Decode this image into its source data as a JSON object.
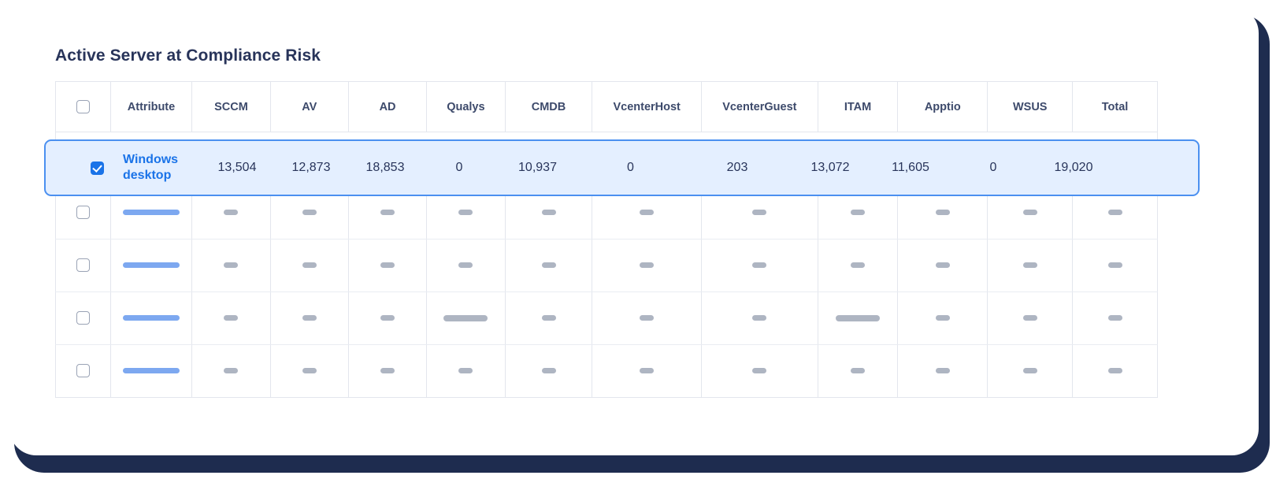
{
  "page_title": "Active Server at Compliance Risk",
  "colors": {
    "frame": "#1e2c4f",
    "title": "#28345a",
    "accent_blue": "#1a73e8",
    "selected_row_bg": "#e4efff",
    "selected_row_border": "#4b90f0",
    "skeleton_blue": "#7da8f0",
    "skeleton_gray": "#aeb5c2",
    "grid_line": "#e3e6ed"
  },
  "table": {
    "select_all_checkbox": {
      "name": "select-all-checkbox",
      "checked": false
    },
    "columns": [
      {
        "key": "check",
        "label": ""
      },
      {
        "key": "attr",
        "label": "Attribute"
      },
      {
        "key": "sccm",
        "label": "SCCM"
      },
      {
        "key": "av",
        "label": "AV"
      },
      {
        "key": "ad",
        "label": "AD"
      },
      {
        "key": "qualys",
        "label": "Qualys"
      },
      {
        "key": "cmdb",
        "label": "CMDB"
      },
      {
        "key": "vch",
        "label": "VcenterHost"
      },
      {
        "key": "vcg",
        "label": "VcenterGuest"
      },
      {
        "key": "itam",
        "label": "ITAM"
      },
      {
        "key": "apptio",
        "label": "Apptio"
      },
      {
        "key": "wsus",
        "label": "WSUS"
      },
      {
        "key": "total",
        "label": "Total"
      }
    ],
    "selected_row": {
      "checked": true,
      "attribute": "Windows desktop",
      "sccm": "13,504",
      "av": "12,873",
      "ad": "18,853",
      "qualys": "0",
      "cmdb": "10,937",
      "vch": "0",
      "vcg": "203",
      "itam": "13,072",
      "apptio": "11,605",
      "wsus": "0",
      "total": "19,020"
    },
    "placeholder_rows": [
      {
        "checked": false,
        "attr": "bar-blue",
        "cells": [
          "bar-gray",
          "bar-gray",
          "bar-gray",
          "bar-gray",
          "bar-gray",
          "bar-gray",
          "bar-gray",
          "bar-gray",
          "bar-gray",
          "bar-gray",
          "bar-gray"
        ]
      },
      {
        "checked": false,
        "attr": "bar-blue",
        "cells": [
          "bar-gray",
          "bar-gray",
          "bar-gray",
          "bar-gray",
          "bar-gray",
          "bar-gray",
          "bar-gray",
          "bar-gray",
          "bar-gray",
          "bar-gray",
          "bar-gray"
        ]
      },
      {
        "checked": false,
        "attr": "bar-blue",
        "cells": [
          "bar-gray",
          "bar-gray",
          "bar-gray",
          "bar-gray-wide",
          "bar-gray",
          "bar-gray",
          "bar-gray",
          "bar-gray-wide",
          "bar-gray",
          "bar-gray",
          "bar-gray"
        ]
      },
      {
        "checked": false,
        "attr": "bar-blue",
        "cells": [
          "bar-gray",
          "bar-gray",
          "bar-gray",
          "bar-gray",
          "bar-gray",
          "bar-gray",
          "bar-gray",
          "bar-gray",
          "bar-gray",
          "bar-gray",
          "bar-gray"
        ]
      }
    ]
  }
}
